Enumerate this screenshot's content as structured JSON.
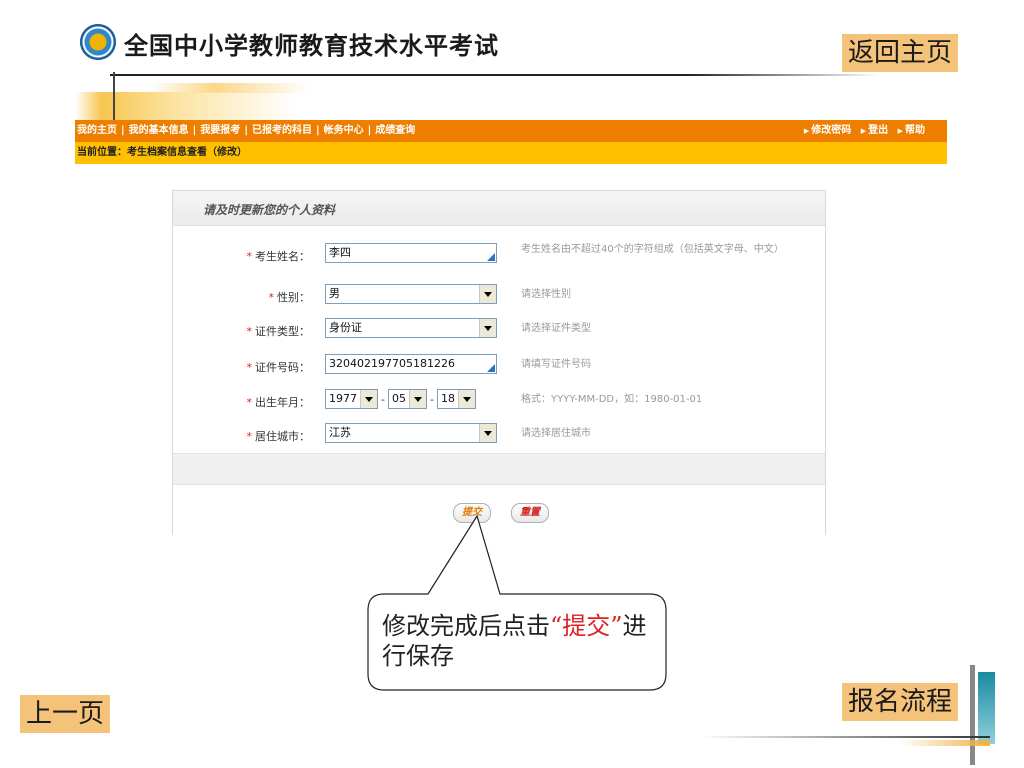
{
  "header": {
    "title": "全国中小学教师教育技术水平考试",
    "back_home": "返回主页"
  },
  "nav": {
    "left_items": [
      "我的主页",
      "我的基本信息",
      "我要报考",
      "已报考的科目",
      "帐务中心",
      "成绩查询"
    ],
    "right_items": [
      "修改密码",
      "登出",
      "帮助"
    ],
    "separator": "|",
    "arrow": "▶"
  },
  "breadcrumb": "当前位置：考生档案信息查看（修改）",
  "form": {
    "title": "请及时更新您的个人资料",
    "required_mark": "*",
    "fields": {
      "name": {
        "label": "考生姓名：",
        "value": "李四",
        "hint": "考生姓名由不超过40个的字符组成（包括英文字母、中文）"
      },
      "gender": {
        "label": "性别：",
        "value": "男",
        "hint": "请选择性别"
      },
      "id_type": {
        "label": "证件类型：",
        "value": "身份证",
        "hint": "请选择证件类型"
      },
      "id_number": {
        "label": "证件号码：",
        "value": "320402197705181226",
        "hint": "请填写证件号码"
      },
      "birth": {
        "label": "出生年月：",
        "year": "1977",
        "month": "05",
        "day": "18",
        "sep": "-",
        "hint": "格式：YYYY-MM-DD，如：1980-01-01"
      },
      "city": {
        "label": "居住城市：",
        "value": "江苏",
        "hint": "请选择居住城市"
      }
    },
    "submit": "提交",
    "reset": "重置"
  },
  "callout": {
    "before": "修改完成后点击",
    "highlight": "“提交”",
    "after": "进行保存"
  },
  "footer": {
    "prev": "上一页",
    "flow": "报名流程"
  },
  "colors": {
    "nav_orange": "#ee7e00",
    "breadcrumb_yellow": "#ffc000",
    "slide_button": "#f5c27a",
    "required_red": "#e02020"
  }
}
